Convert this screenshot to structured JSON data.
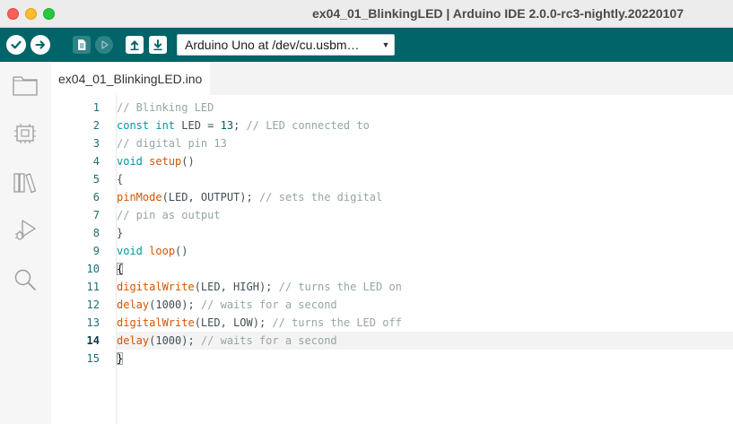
{
  "window": {
    "title": "ex04_01_BlinkingLED | Arduino IDE 2.0.0-rc3-nightly.20220107"
  },
  "colors": {
    "toolbar": "#006468",
    "comment": "#95a5a6",
    "keyword": "#00979d",
    "function": "#d35400",
    "plain": "#434f54"
  },
  "toolbar": {
    "verify_icon": "checkmark-icon",
    "upload_icon": "right-arrow-icon",
    "new_icon": "new-sketch-icon",
    "debug_icon": "debug-icon",
    "open_icon": "open-sketch-icon",
    "save_icon": "save-sketch-icon",
    "board_select_value": "Arduino Uno at /dev/cu.usbm…"
  },
  "activitybar": {
    "items": [
      "folder-icon",
      "board-manager-icon",
      "library-manager-icon",
      "debug-icon",
      "search-icon"
    ]
  },
  "editor": {
    "tab_label": "ex04_01_BlinkingLED.ino",
    "current_line": 14,
    "lines": [
      {
        "n": "1",
        "segments": [
          [
            "cmt",
            "// Blinking LED"
          ]
        ]
      },
      {
        "n": "2",
        "segments": [
          [
            "kw",
            "const"
          ],
          [
            "txt",
            " "
          ],
          [
            "kw",
            "int"
          ],
          [
            "txt",
            " LED = "
          ],
          [
            "num",
            "13"
          ],
          [
            "txt",
            "; "
          ],
          [
            "cmt",
            "// LED connected to"
          ]
        ]
      },
      {
        "n": "3",
        "segments": [
          [
            "cmt",
            "// digital pin 13"
          ]
        ]
      },
      {
        "n": "4",
        "segments": [
          [
            "kw",
            "void"
          ],
          [
            "txt",
            " "
          ],
          [
            "fn",
            "setup"
          ],
          [
            "txt",
            "()"
          ]
        ]
      },
      {
        "n": "5",
        "segments": [
          [
            "txt",
            "{"
          ]
        ]
      },
      {
        "n": "6",
        "segments": [
          [
            "fn",
            "pinMode"
          ],
          [
            "txt",
            "(LED, OUTPUT); "
          ],
          [
            "cmt",
            "// sets the digital"
          ]
        ]
      },
      {
        "n": "7",
        "segments": [
          [
            "cmt",
            "// pin as output"
          ]
        ]
      },
      {
        "n": "8",
        "segments": [
          [
            "txt",
            "}"
          ]
        ]
      },
      {
        "n": "9",
        "segments": [
          [
            "kw",
            "void"
          ],
          [
            "txt",
            " "
          ],
          [
            "fn",
            "loop"
          ],
          [
            "txt",
            "()"
          ]
        ]
      },
      {
        "n": "10",
        "segments": [
          [
            "brkt",
            "{"
          ]
        ]
      },
      {
        "n": "11",
        "segments": [
          [
            "fn",
            "digitalWrite"
          ],
          [
            "txt",
            "(LED, HIGH); "
          ],
          [
            "cmt",
            "// turns the LED on"
          ]
        ]
      },
      {
        "n": "12",
        "segments": [
          [
            "fn",
            "delay"
          ],
          [
            "txt",
            "(1000); "
          ],
          [
            "cmt",
            "// waits for a second"
          ]
        ]
      },
      {
        "n": "13",
        "segments": [
          [
            "fn",
            "digitalWrite"
          ],
          [
            "txt",
            "(LED, LOW); "
          ],
          [
            "cmt",
            "// turns the LED off"
          ]
        ]
      },
      {
        "n": "14",
        "segments": [
          [
            "fn",
            "delay"
          ],
          [
            "txt",
            "(1000); "
          ],
          [
            "cmt",
            "// waits for a second"
          ]
        ]
      },
      {
        "n": "15",
        "segments": [
          [
            "brkt",
            "}"
          ]
        ]
      }
    ]
  }
}
